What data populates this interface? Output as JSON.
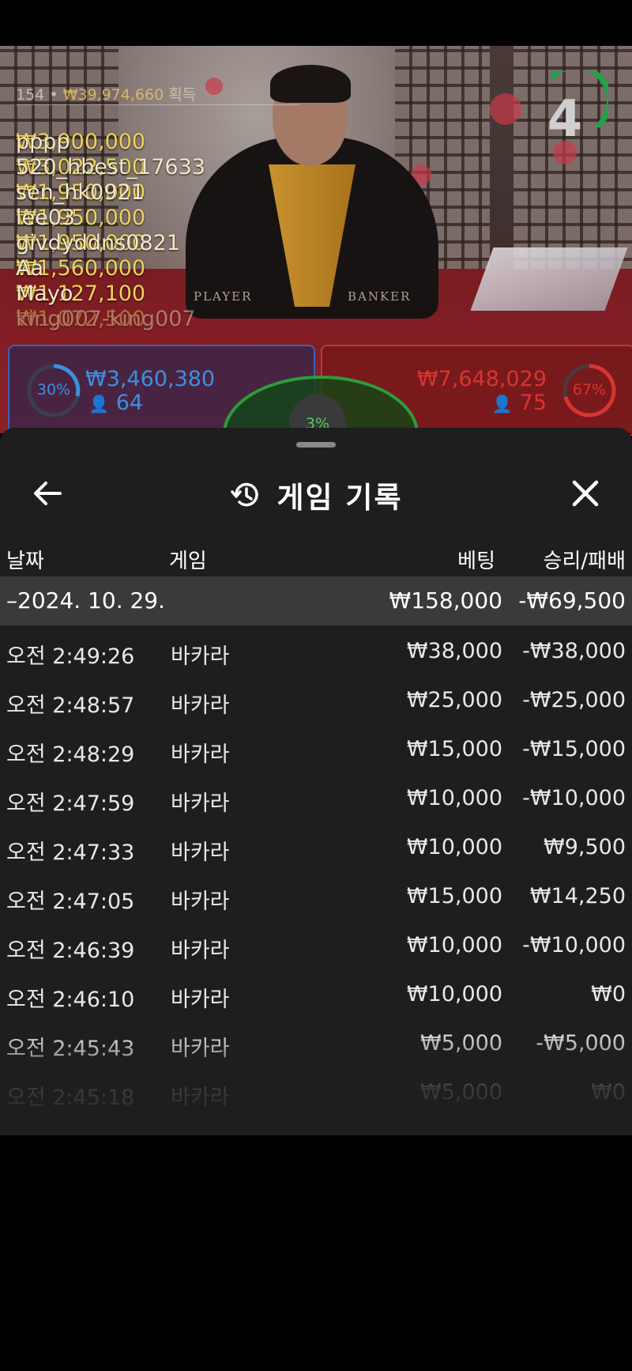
{
  "stream": {
    "ticker": {
      "head_count": "154",
      "head_amount": "₩39,974,660",
      "head_suffix": "획득",
      "rows": [
        {
          "amount": "₩3,900,000",
          "name": "pppp"
        },
        {
          "amount": "₩3,022,500",
          "name": "520_hbest_17633"
        },
        {
          "amount": "₩1,950,000",
          "name": "sen_hk0921"
        },
        {
          "amount": "₩1,950,000",
          "name": "lee03"
        },
        {
          "amount": "₩1,950,000",
          "name": "givdyddns0821"
        },
        {
          "amount": "₩1,560,000",
          "name": "Aa"
        },
        {
          "amount": "₩1,127,100",
          "name": "Mayo"
        },
        {
          "amount": "₩1,072,500",
          "name": "king007-king007"
        }
      ]
    },
    "countdown": "4",
    "felt_player": "PLAYER",
    "felt_banker": "BANKER",
    "player": {
      "percent": "30%",
      "amount": "₩3,460,380",
      "count": "64"
    },
    "banker": {
      "percent": "67%",
      "amount": "₩7,648,029",
      "count": "75"
    },
    "tie": {
      "percent": "3%"
    }
  },
  "sheet": {
    "title": "게임 기록",
    "columns": {
      "date": "날짜",
      "game": "게임",
      "bet": "베팅",
      "winloss": "승리/패배"
    },
    "date_group": {
      "label": "–2024. 10. 29.",
      "bet": "₩158,000",
      "winloss": "-₩69,500"
    },
    "rows": [
      {
        "time": "오전 2:49:26",
        "game": "바카라",
        "bet": "₩38,000",
        "winloss": "-₩38,000"
      },
      {
        "time": "오전 2:48:57",
        "game": "바카라",
        "bet": "₩25,000",
        "winloss": "-₩25,000"
      },
      {
        "time": "오전 2:48:29",
        "game": "바카라",
        "bet": "₩15,000",
        "winloss": "-₩15,000"
      },
      {
        "time": "오전 2:47:59",
        "game": "바카라",
        "bet": "₩10,000",
        "winloss": "-₩10,000"
      },
      {
        "time": "오전 2:47:33",
        "game": "바카라",
        "bet": "₩10,000",
        "winloss": "₩9,500"
      },
      {
        "time": "오전 2:47:05",
        "game": "바카라",
        "bet": "₩15,000",
        "winloss": "₩14,250"
      },
      {
        "time": "오전 2:46:39",
        "game": "바카라",
        "bet": "₩10,000",
        "winloss": "-₩10,000"
      },
      {
        "time": "오전 2:46:10",
        "game": "바카라",
        "bet": "₩10,000",
        "winloss": "₩0"
      },
      {
        "time": "오전 2:45:43",
        "game": "바카라",
        "bet": "₩5,000",
        "winloss": "-₩5,000"
      },
      {
        "time": "오전 2:45:18",
        "game": "바카라",
        "bet": "₩5,000",
        "winloss": "₩0"
      }
    ]
  },
  "colors": {
    "player_blue": "#3d8fe0",
    "banker_red": "#d8342f",
    "tie_green": "#3cb54a",
    "ticker_gold": "#f0d25a",
    "sheet_bg": "#1e1e1e"
  },
  "icons": {
    "back": "arrow-left-icon",
    "history": "history-icon",
    "close": "close-icon",
    "person": "person-icon"
  }
}
